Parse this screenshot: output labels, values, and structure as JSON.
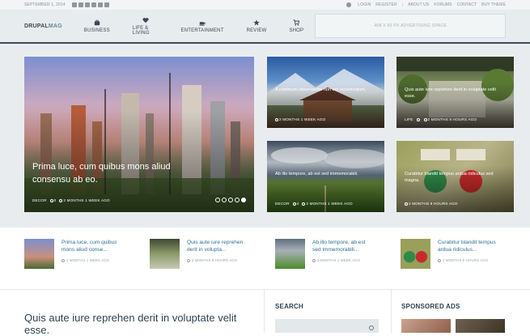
{
  "topbar": {
    "date": "SEPTEMBER 1, 2014",
    "social_icons": [
      "facebook-icon",
      "twitter-icon",
      "google-plus-icon",
      "vimeo-icon",
      "youtube-icon",
      "rss-icon"
    ],
    "links": [
      "LOGIN",
      "REGISTER",
      "ABOUT US",
      "FORUMS",
      "CONTACT",
      "BUY THEME"
    ]
  },
  "header": {
    "logo_a": "DRUPAL",
    "logo_b": "MAG",
    "nav": [
      {
        "label": "BUSINESS",
        "icon": "briefcase-icon"
      },
      {
        "label": "LIFE & LIVING",
        "icon": "heart-icon"
      },
      {
        "label": "ENTERTAINMENT",
        "icon": "coffee-cup-icon"
      },
      {
        "label": "REVIEW",
        "icon": "star-icon"
      },
      {
        "label": "SHOP",
        "icon": "cart-icon"
      }
    ],
    "ad_text": "468 X 60 PX ADVERTISING SPACE"
  },
  "hero": {
    "main": {
      "title": "Prima luce, cum quibus mons aliud consensu ab eo.",
      "category": "DECOR",
      "comments": "0",
      "time": "2 MONTHS 1 WEEK AGO"
    },
    "cards": [
      {
        "title": "A communi observantia non est recedendum.",
        "category": "",
        "comments": "",
        "time": "2 MONTHS 1 WEEK AGO"
      },
      {
        "title": "Quis aute iure reprehen derit in voluptate velit esse.",
        "category": "LIFE",
        "comments": "",
        "time": "2 MONTHS 9 HOURS AGO"
      },
      {
        "title": "Ab illo tempore, ab est sed immemorabili.",
        "category": "DECOR",
        "comments": "4",
        "time": "2 MONTHS 1 WEEK AGO"
      },
      {
        "title": "Curabitur blandit tempus ardua ridiculus sed magna.",
        "category": "",
        "comments": "",
        "time": "2 MONTHS 9 HOURS AGO"
      }
    ]
  },
  "strip": [
    {
      "title": "Prima luce, cum quibus mons aliud conse...",
      "time": "2 MONTHS 1 WEEK AGO"
    },
    {
      "title": "Quis aute iure reprehen derit in volupta...",
      "time": "2 MONTHS 9 HOURS AGO"
    },
    {
      "title": "Ab illo tempore, ab est sed immemorabili...",
      "time": "2 MONTHS 1 WEEK AGO"
    },
    {
      "title": "Curabitur blandit tempus ardua ridiculus...",
      "time": "2 MONTHS 9 HOURS AGO"
    }
  ],
  "bottom": {
    "article_title": "Quis aute iure reprehen derit in voluptate velit esse.",
    "search_title": "SEARCH",
    "sponsored_title": "SPONSORED ADS"
  }
}
